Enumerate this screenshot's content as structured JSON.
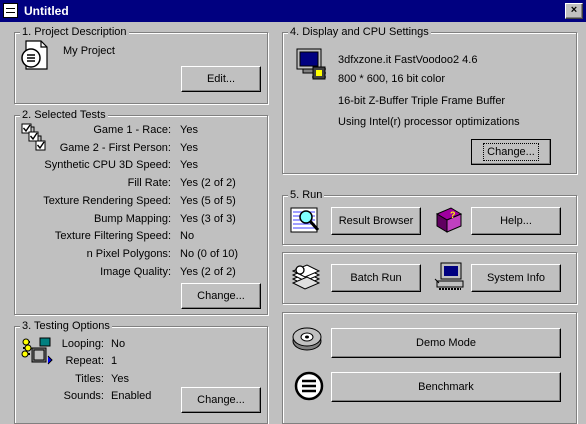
{
  "window": {
    "title": "Untitled",
    "close_glyph": "×"
  },
  "project": {
    "legend": "1. Project Description",
    "name": "My Project",
    "edit_label": "Edit..."
  },
  "tests": {
    "legend": "2. Selected Tests",
    "rows": [
      {
        "label": "Game 1 - Race:",
        "value": "Yes"
      },
      {
        "label": "Game 2 - First Person:",
        "value": "Yes"
      },
      {
        "label": "Synthetic CPU 3D Speed:",
        "value": "Yes"
      },
      {
        "label": "Fill Rate:",
        "value": "Yes (2 of 2)"
      },
      {
        "label": "Texture Rendering Speed:",
        "value": "Yes (5 of 5)"
      },
      {
        "label": "Bump Mapping:",
        "value": "Yes (3 of 3)"
      },
      {
        "label": "Texture Filtering Speed:",
        "value": "No"
      },
      {
        "label": "n Pixel Polygons:",
        "value": "No (0 of 10)"
      },
      {
        "label": "Image Quality:",
        "value": "Yes (2 of 2)"
      }
    ],
    "change_label": "Change..."
  },
  "options": {
    "legend": "3. Testing Options",
    "rows": [
      {
        "label": "Looping:",
        "value": "No"
      },
      {
        "label": "Repeat:",
        "value": "1"
      },
      {
        "label": "Titles:",
        "value": "Yes"
      },
      {
        "label": "Sounds:",
        "value": "Enabled"
      }
    ],
    "change_label": "Change..."
  },
  "display": {
    "legend": "4. Display and CPU Settings",
    "lines": [
      "3dfxzone.it FastVoodoo2 4.6",
      "800 * 600, 16 bit color",
      "16-bit Z-Buffer  Triple Frame Buffer",
      "Using  Intel(r) processor optimizations"
    ],
    "change_label": "Change..."
  },
  "run": {
    "legend": "5. Run",
    "result_browser": "Result Browser",
    "help": "Help...",
    "batch_run": "Batch Run",
    "system_info": "System Info",
    "demo_mode": "Demo Mode",
    "benchmark": "Benchmark"
  },
  "icons": {
    "app": "window-app-icon",
    "project": "document-icon",
    "tests": "checklist-icon",
    "options": "options-gears-icon",
    "display": "monitor-chip-icon",
    "result_browser": "magnifier-sheet-icon",
    "help": "help-book-icon",
    "batch": "stacked-sheets-icon",
    "system_info": "computer-icon",
    "demo": "demo-disc-icon",
    "benchmark": "benchmark-circle-icon"
  }
}
